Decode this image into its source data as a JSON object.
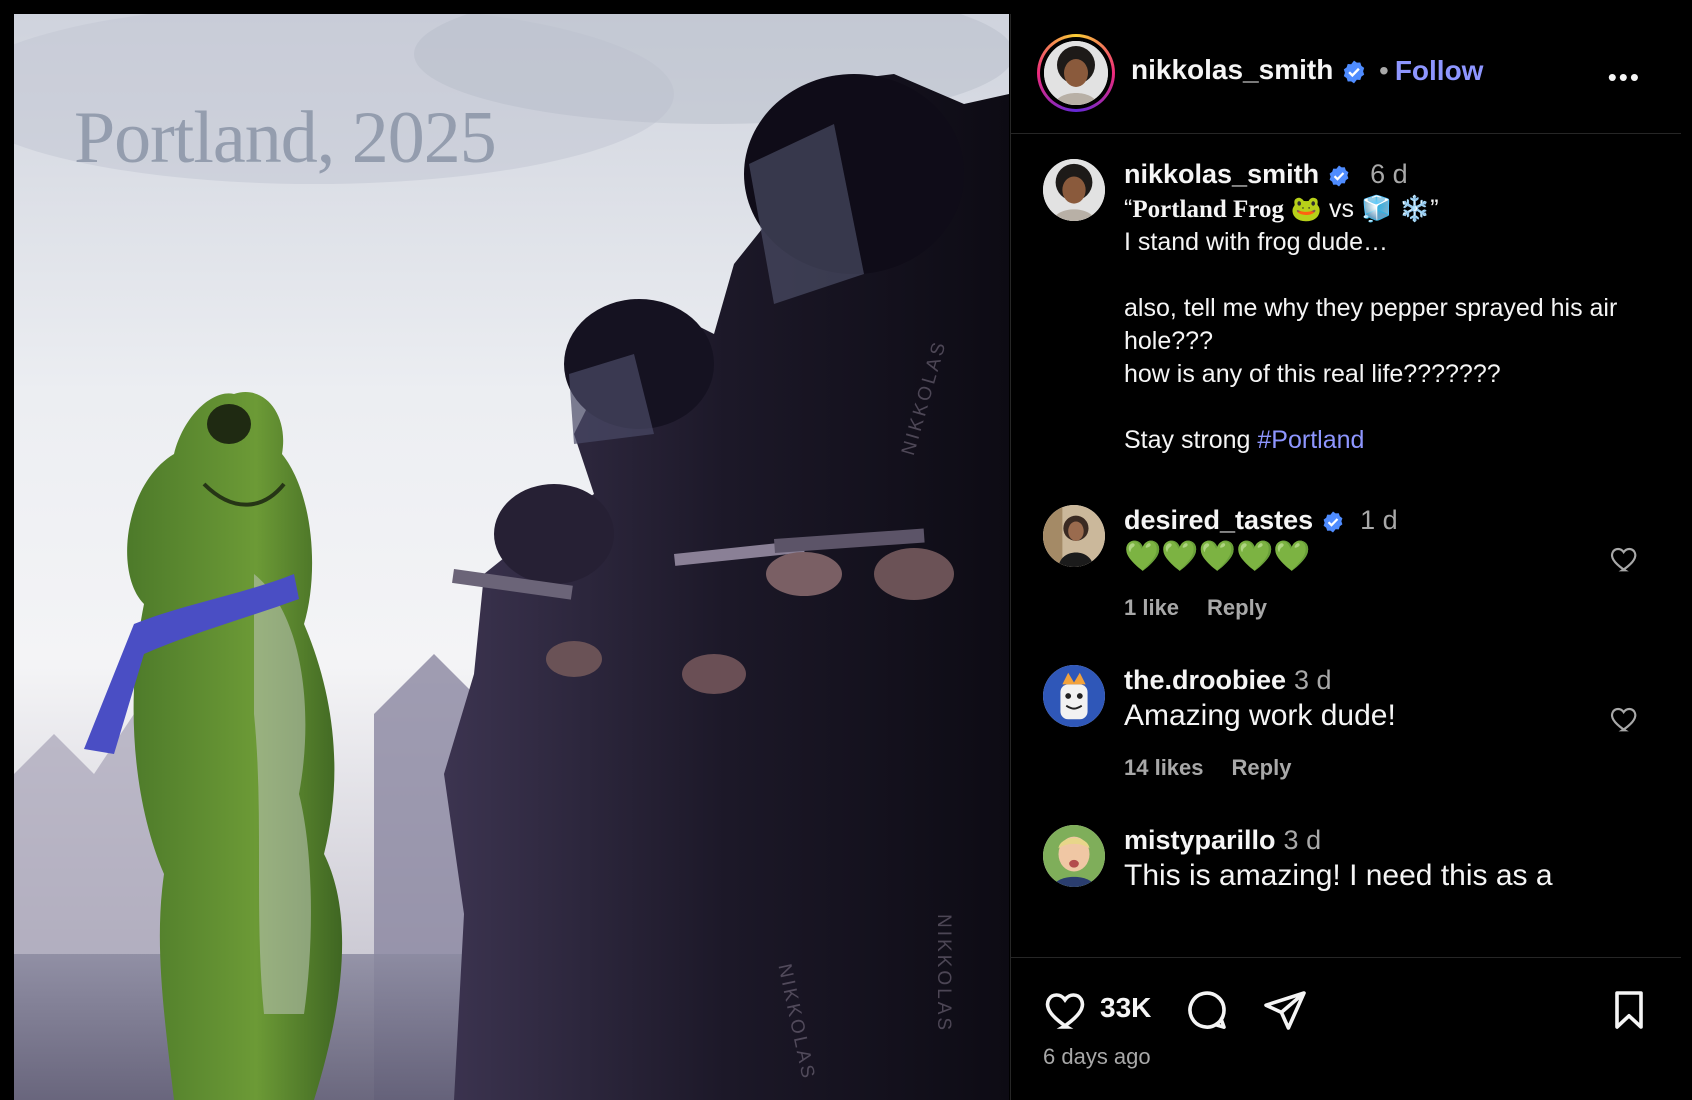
{
  "artwork": {
    "title": "Portland, 2025",
    "watermark": "NIKKOLAS"
  },
  "header": {
    "username": "nikkolas_smith",
    "separator": "•",
    "follow_label": "Follow",
    "more_label": "•••"
  },
  "caption": {
    "username": "nikkolas_smith",
    "time": "6 d",
    "line1_open": "“",
    "line1_bold": "Portland Frog",
    "line1_frog": "🐸",
    "line1_vs": " vs ",
    "line1_ice": "🧊",
    "line1_snow": "❄️",
    "line1_close": "”",
    "body": "I stand with frog dude…\n\nalso, tell me why they pepper sprayed his air hole???\nhow is any of this real life???????\n\nStay strong ",
    "hashtag": "#Portland"
  },
  "comments": [
    {
      "username": "desired_tastes",
      "verified": true,
      "time": "1 d",
      "text": "💚💚💚💚💚",
      "likes": "1 like",
      "reply": "Reply"
    },
    {
      "username": "the.droobiee",
      "verified": false,
      "time": "3 d",
      "text": "Amazing work dude!",
      "likes": "14 likes",
      "reply": "Reply"
    },
    {
      "username": "mistyparillo",
      "verified": false,
      "time": "3 d",
      "text": "This is amazing! I need this as a",
      "likes": "",
      "reply": ""
    }
  ],
  "footer": {
    "like_count": "33K",
    "posted": "6 days ago"
  },
  "colors": {
    "link": "#8e96ff",
    "verified": "#4f8cff",
    "muted": "#a8a8a8"
  },
  "icons": [
    "verified-badge-icon",
    "more-options-icon",
    "heart-icon",
    "comment-icon",
    "share-icon",
    "bookmark-icon"
  ]
}
